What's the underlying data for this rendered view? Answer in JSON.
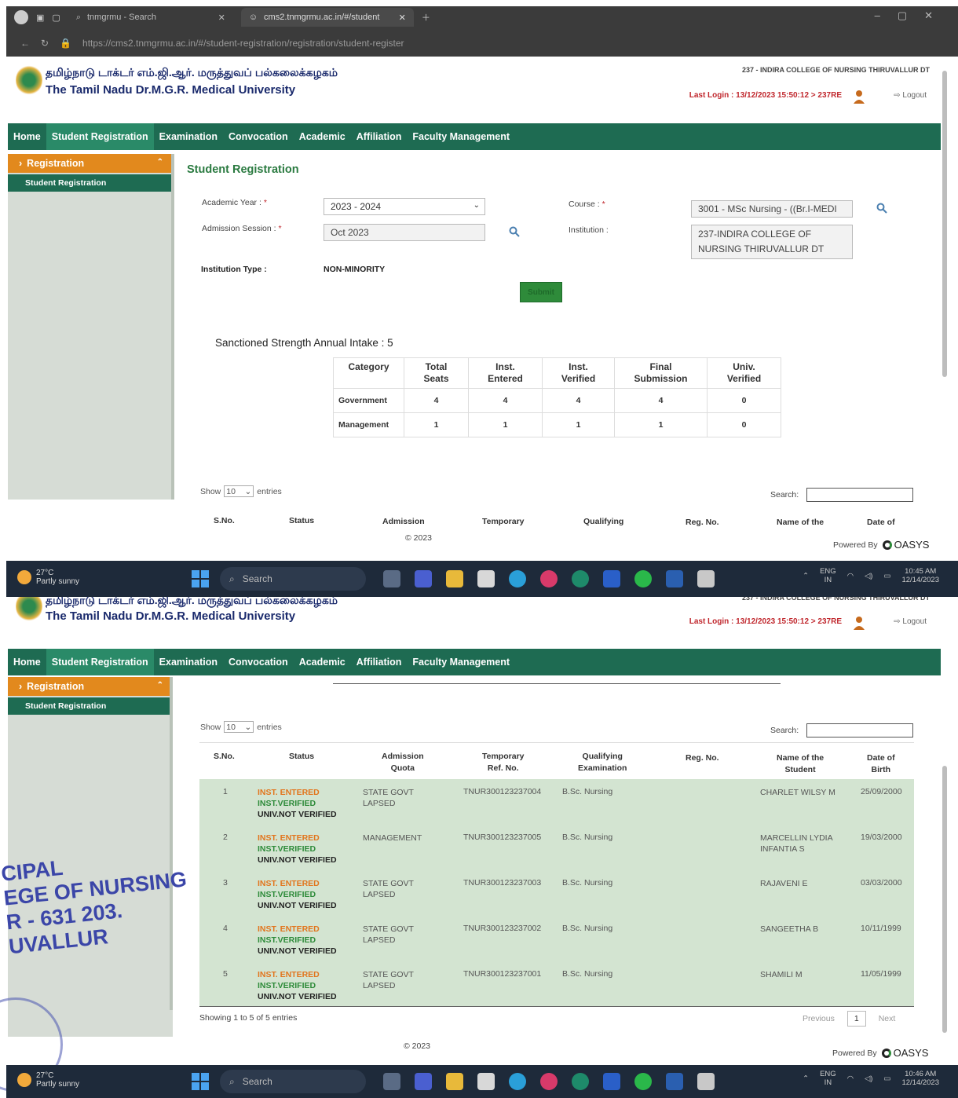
{
  "browser": {
    "tabs": [
      "tnmgrmu - Search",
      "cms2.tnmgrmu.ac.in/#/student"
    ],
    "url": "https://cms2.tnmgrmu.ac.in/#/student-registration/registration/student-register"
  },
  "header": {
    "uni_tamil": "தமிழ்நாடு டாக்டர் எம்.ஜி.ஆர். மருத்துவப் பல்கலைக்கழகம்",
    "uni_en": "The Tamil Nadu Dr.M.G.R. Medical University",
    "college": "237 - INDIRA COLLEGE OF NURSING THIRUVALLUR DT",
    "last_login": "Last Login : 13/12/2023 15:50:12 > 237RE",
    "logout": "Logout"
  },
  "nav": [
    "Home",
    "Student Registration",
    "Examination",
    "Convocation",
    "Academic",
    "Affiliation",
    "Faculty Management"
  ],
  "sidebar": {
    "section": "Registration",
    "item": "Student Registration"
  },
  "form": {
    "title": "Student Registration",
    "academic_year_label": "Academic Year :",
    "academic_year": "2023 - 2024",
    "admission_session_label": "Admission Session :",
    "admission_session": "Oct 2023",
    "course_label": "Course :",
    "course": "3001 - MSc Nursing - ((Br.I-MEDI",
    "institution_label": "Institution :",
    "institution_line1": "237-INDIRA COLLEGE OF",
    "institution_line2": "NURSING THIRUVALLUR DT",
    "institution_type_label": "Institution Type :",
    "institution_type": "NON-MINORITY",
    "submit": "Submit",
    "required_mark": "*"
  },
  "summary": {
    "heading": "Sanctioned Strength Annual Intake : 5",
    "headers": [
      [
        "Category"
      ],
      [
        "Total",
        "Seats"
      ],
      [
        "Inst.",
        "Entered"
      ],
      [
        "Inst.",
        "Verified"
      ],
      [
        "Final",
        "Submission"
      ],
      [
        "Univ.",
        "Verified"
      ]
    ],
    "rows": [
      {
        "category": "Government",
        "total": "4",
        "entered": "4",
        "verified": "4",
        "final": "4",
        "univ": "0"
      },
      {
        "category": "Management",
        "total": "1",
        "entered": "1",
        "verified": "1",
        "final": "1",
        "univ": "0"
      }
    ]
  },
  "list": {
    "show": "Show",
    "entries_value": "10",
    "entries": "entries",
    "search": "Search:",
    "headers_short": [
      "S.No.",
      "Status",
      "Admission",
      "Temporary",
      "Qualifying",
      "Reg. No.",
      "Name of the",
      "Date of"
    ],
    "headers": {
      "sno": "S.No.",
      "status": "Status",
      "quota": [
        "Admission",
        "Quota"
      ],
      "ref": [
        "Temporary",
        "Ref. No."
      ],
      "qual": [
        "Qualifying",
        "Examination"
      ],
      "reg": "Reg. No.",
      "name": [
        "Name of the",
        "Student"
      ],
      "dob": [
        "Date of",
        "Birth"
      ]
    },
    "status_lines": [
      "INST. ENTERED",
      "INST.VERIFIED",
      "UNIV.NOT VERIFIED"
    ],
    "rows": [
      {
        "sno": "1",
        "quota1": "STATE GOVT",
        "quota2": "LAPSED",
        "ref": "TNUR300123237004",
        "qual": "B.Sc. Nursing",
        "name1": "CHARLET WILSY M",
        "name2": "",
        "dob": "25/09/2000"
      },
      {
        "sno": "2",
        "quota1": "MANAGEMENT",
        "quota2": "",
        "ref": "TNUR300123237005",
        "qual": "B.Sc. Nursing",
        "name1": "MARCELLIN LYDIA",
        "name2": "INFANTIA S",
        "dob": "19/03/2000"
      },
      {
        "sno": "3",
        "quota1": "STATE GOVT",
        "quota2": "LAPSED",
        "ref": "TNUR300123237003",
        "qual": "B.Sc. Nursing",
        "name1": "RAJAVENI E",
        "name2": "",
        "dob": "03/03/2000"
      },
      {
        "sno": "4",
        "quota1": "STATE GOVT",
        "quota2": "LAPSED",
        "ref": "TNUR300123237002",
        "qual": "B.Sc. Nursing",
        "name1": "SANGEETHA B",
        "name2": "",
        "dob": "10/11/1999"
      },
      {
        "sno": "5",
        "quota1": "STATE GOVT",
        "quota2": "LAPSED",
        "ref": "TNUR300123237001",
        "qual": "B.Sc. Nursing",
        "name1": "SHAMILI M",
        "name2": "",
        "dob": "11/05/1999"
      }
    ],
    "info": "Showing 1 to 5 of 5 entries",
    "prev": "Previous",
    "page": "1",
    "next": "Next"
  },
  "footer": {
    "copy": "© 2023",
    "powered": "Powered By",
    "brand": "OASYS"
  },
  "taskbar": {
    "temp": "27°C",
    "weather": "Partly sunny",
    "search": "Search",
    "lang1": "ENG",
    "lang2": "IN",
    "time1": "10:45 AM",
    "time2": "10:46 AM",
    "date": "12/14/2023"
  },
  "stamp": [
    "CIPAL",
    "EGE OF NURSING",
    "R - 631 203.",
    "UVALLUR"
  ]
}
